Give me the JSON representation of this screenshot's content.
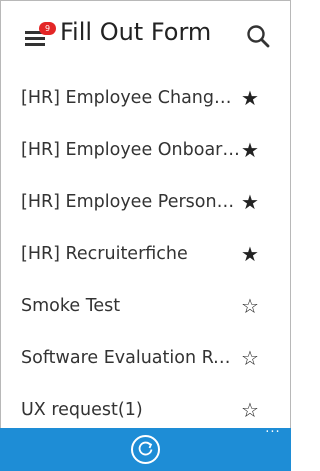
{
  "header": {
    "title": "Fill Out Form",
    "notification_count": "9"
  },
  "forms": [
    {
      "label": "[HR] Employee Change…",
      "starred": true
    },
    {
      "label": "[HR] Employee Onboar…",
      "starred": true
    },
    {
      "label": "[HR] Employee Persona…",
      "starred": true
    },
    {
      "label": "[HR] Recruiterfiche",
      "starred": true
    },
    {
      "label": "Smoke Test",
      "starred": false
    },
    {
      "label": "Software Evaluation Re…",
      "starred": false
    },
    {
      "label": "UX request(1)",
      "starred": false
    }
  ],
  "appbar": {
    "more_label": "···",
    "color": "#1e8dd6"
  },
  "icons": {
    "menu": "hamburger-menu-icon",
    "search": "search-icon",
    "star_filled": "★",
    "star_empty": "☆",
    "refresh": "refresh-icon"
  }
}
